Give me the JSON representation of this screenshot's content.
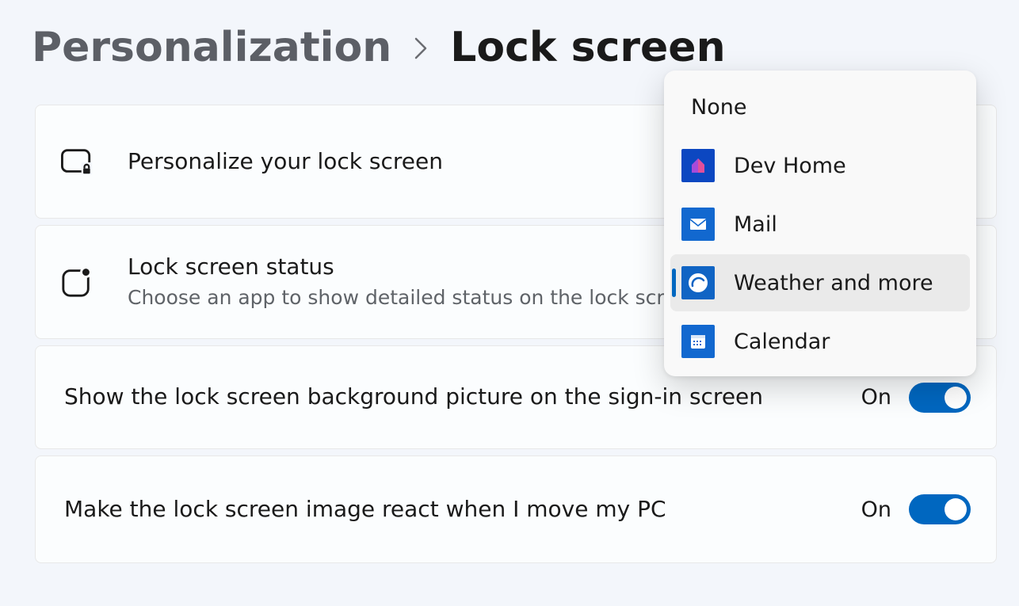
{
  "breadcrumb": {
    "parent": "Personalization",
    "current": "Lock screen"
  },
  "cards": {
    "personalize": {
      "title": "Personalize your lock screen"
    },
    "status": {
      "title": "Lock screen status",
      "subtitle": "Choose an app to show detailed status on the lock screen"
    },
    "bgOnSignin": {
      "title": "Show the lock screen background picture on the sign-in screen",
      "stateLabel": "On"
    },
    "parallax": {
      "title": "Make the lock screen image react when I move my PC",
      "stateLabel": "On"
    }
  },
  "dropdown": {
    "none": "None",
    "items": [
      {
        "label": "Dev Home",
        "icon": "devhome"
      },
      {
        "label": "Mail",
        "icon": "mail"
      },
      {
        "label": "Weather and more",
        "icon": "weather",
        "selected": true
      },
      {
        "label": "Calendar",
        "icon": "calendar"
      }
    ]
  }
}
